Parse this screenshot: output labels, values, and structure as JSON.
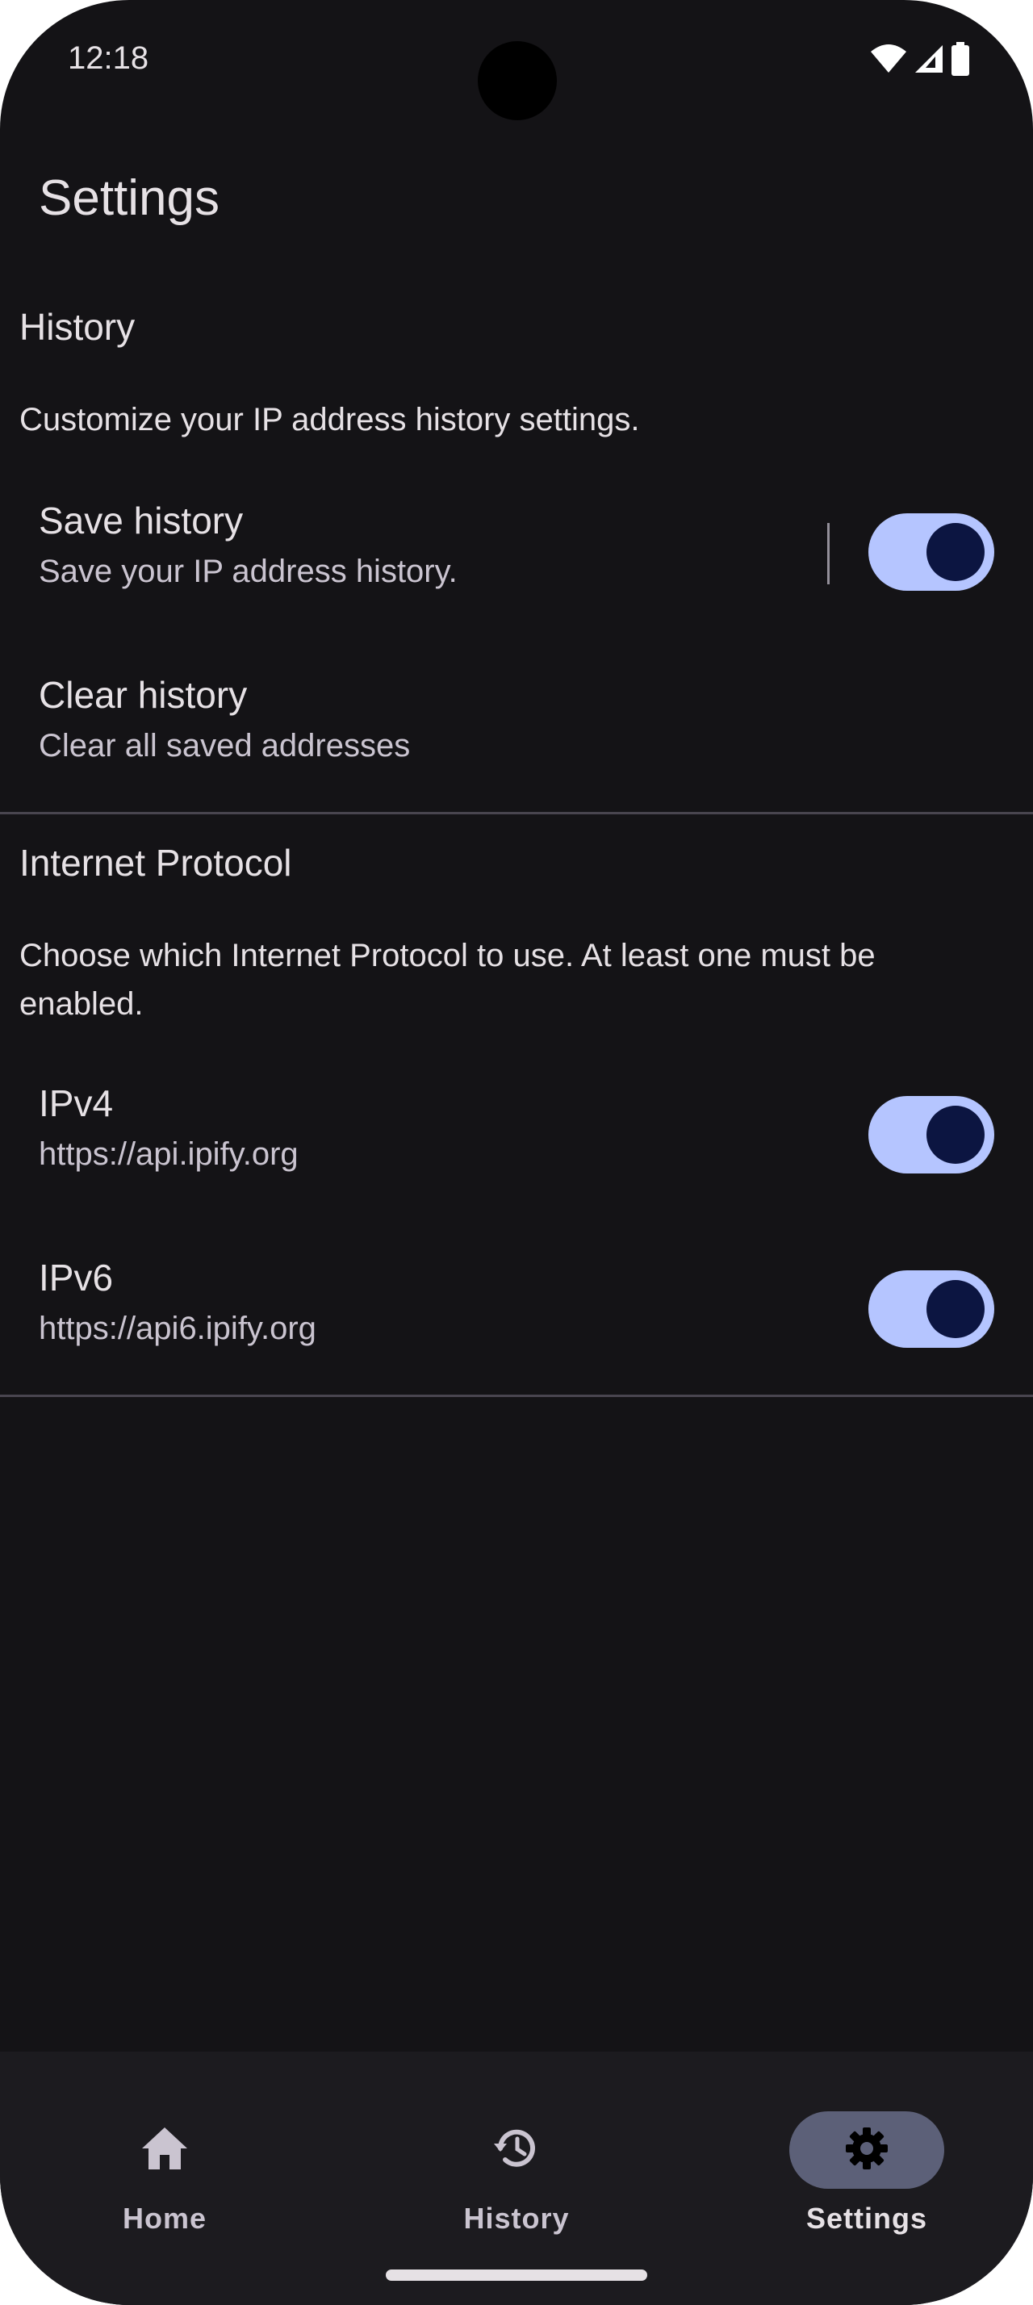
{
  "status_bar": {
    "time": "12:18",
    "icons": [
      "wifi-icon",
      "cell-signal-icon",
      "battery-icon"
    ]
  },
  "app_bar": {
    "title": "Settings"
  },
  "sections": {
    "history": {
      "header": "History",
      "description": "Customize your IP address history settings.",
      "save_history": {
        "title": "Save history",
        "summary": "Save your IP address history.",
        "enabled": true
      },
      "clear_history": {
        "title": "Clear history",
        "summary": "Clear all saved addresses"
      }
    },
    "protocol": {
      "header": "Internet Protocol",
      "description": "Choose which Internet Protocol to use. At least one must be enabled.",
      "ipv4": {
        "title": "IPv4",
        "summary": "https://api.ipify.org",
        "enabled": true
      },
      "ipv6": {
        "title": "IPv6",
        "summary": "https://api6.ipify.org",
        "enabled": true
      }
    }
  },
  "bottom_nav": {
    "items": [
      {
        "label": "Home",
        "icon": "home-icon",
        "active": false
      },
      {
        "label": "History",
        "icon": "history-icon",
        "active": false
      },
      {
        "label": "Settings",
        "icon": "gear-icon",
        "active": true
      }
    ]
  },
  "colors": {
    "background": "#141316",
    "on_surface": "#e6e1e5",
    "switch_track": "#b5c5ff",
    "switch_thumb": "#0c1541",
    "nav_background": "#1c1b1f",
    "nav_active_indicator": "#5c6078"
  }
}
